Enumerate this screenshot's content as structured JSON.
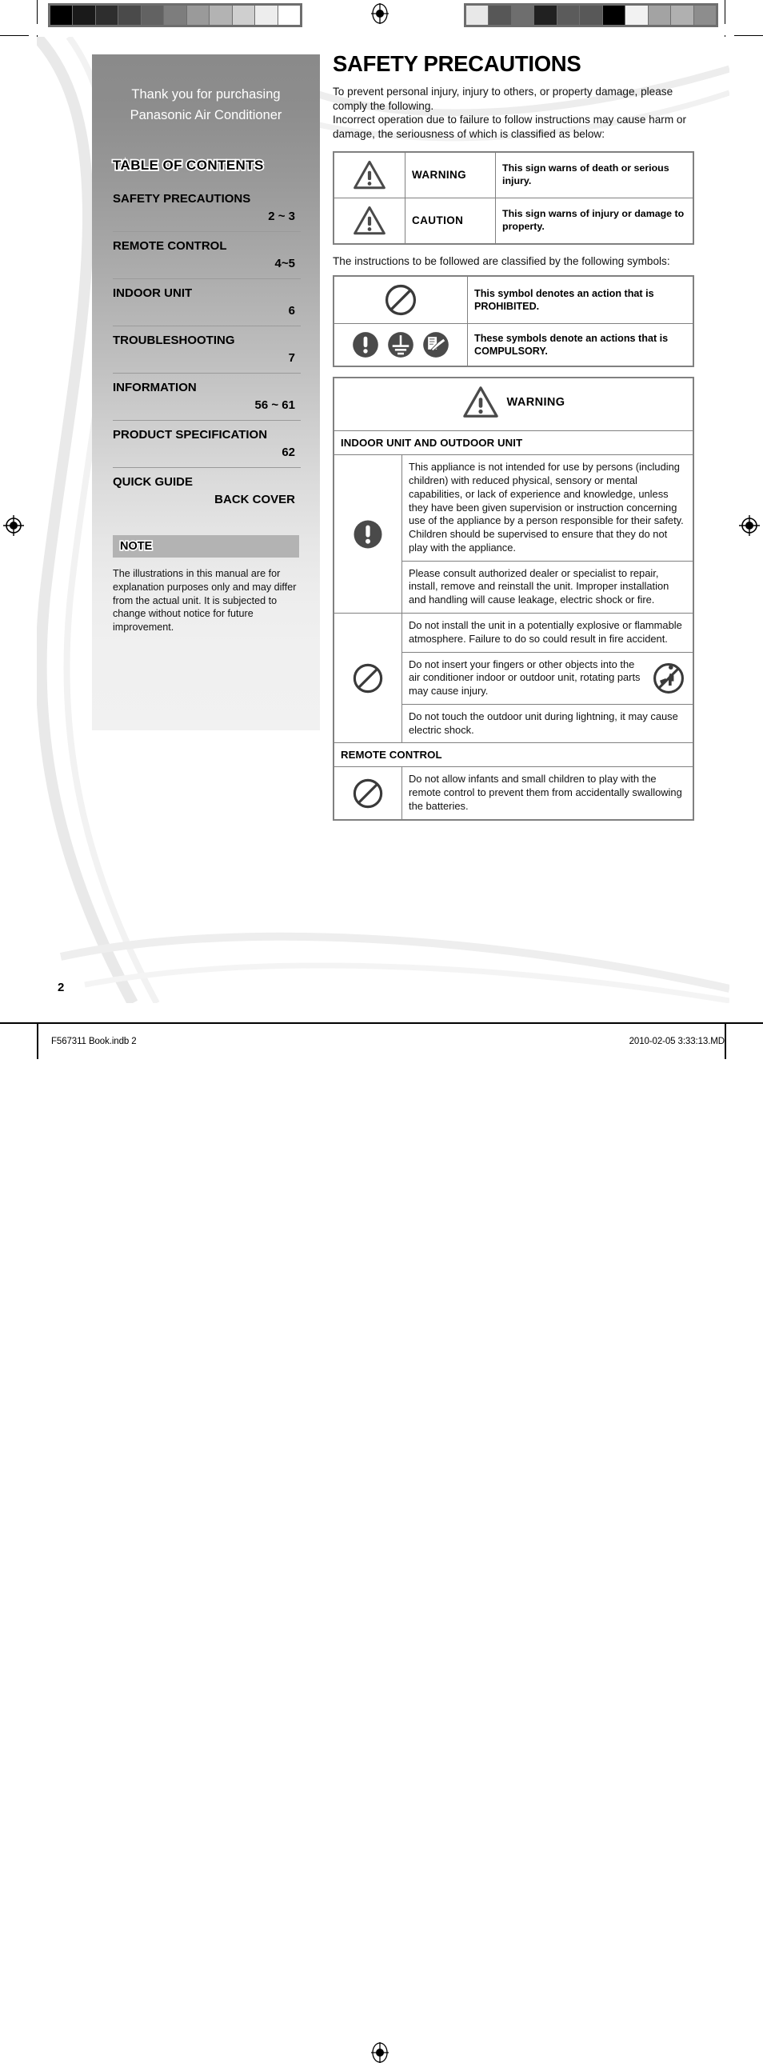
{
  "print_marks": {
    "left_strip_label": "grayscale-calibration-strip-left",
    "right_strip_label": "grayscale-calibration-strip-right",
    "left_swatches": [
      "#000000",
      "#1a1a1a",
      "#2e2e2e",
      "#4a4a4a",
      "#626262",
      "#7d7d7d",
      "#9a9a9a",
      "#b3b3b3",
      "#cfcfcf",
      "#ededed",
      "#ffffff"
    ],
    "right_swatches": [
      "#e8e8e8",
      "#575757",
      "#6e6e6e",
      "#212121",
      "#5b5b5b",
      "#585858",
      "#000000",
      "#f2f2f2",
      "#a3a3a3",
      "#b0b0b0",
      "#8d8d8d"
    ]
  },
  "sidebar": {
    "thanks_line1": "Thank you for purchasing",
    "thanks_line2": "Panasonic Air Conditioner",
    "toc_heading": "TABLE OF CONTENTS",
    "toc": [
      {
        "label": "SAFETY PRECAUTIONS",
        "page": "2 ~ 3"
      },
      {
        "label": "REMOTE CONTROL",
        "page": "4~5"
      },
      {
        "label": "INDOOR UNIT",
        "page": "6"
      },
      {
        "label": "TROUBLESHOOTING",
        "page": "7"
      },
      {
        "label": "INFORMATION",
        "page": "56 ~ 61"
      },
      {
        "label": "PRODUCT SPECIFICATION",
        "page": "62"
      },
      {
        "label": "QUICK GUIDE",
        "page": "BACK COVER"
      }
    ],
    "note_heading": "NOTE",
    "note_text": "The illustrations in this manual are for explanation purposes only and may differ from the actual unit. It is subjected to change without notice for future improvement."
  },
  "main": {
    "title": "SAFETY PRECAUTIONS",
    "intro_p1": "To prevent personal injury, injury to others, or property damage, please comply the following.",
    "intro_p2": "Incorrect operation due to failure to follow instructions may cause harm or damage, the seriousness of which is classified as below:",
    "sign_table": [
      {
        "icon": "warning-triangle-icon",
        "word": "WARNING",
        "desc": "This sign warns of death or serious injury."
      },
      {
        "icon": "warning-triangle-icon",
        "word": "CAUTION",
        "desc": "This sign warns of injury or damage to property."
      }
    ],
    "symbols_intro": "The instructions to be followed are classified by the following symbols:",
    "symbol_table": [
      {
        "icons": [
          "prohibition-circle-icon"
        ],
        "desc": "This symbol denotes an action that is PROHIBITED."
      },
      {
        "icons": [
          "compulsory-exclamation-icon",
          "earth-ground-icon",
          "read-manual-icon"
        ],
        "desc": "These symbols denote an actions that is COMPULSORY."
      }
    ],
    "warning_block": {
      "banner_label": "WARNING",
      "banner_icon": "warning-triangle-icon",
      "sections": [
        {
          "heading": "INDOOR UNIT AND OUTDOOR UNIT",
          "groups": [
            {
              "icon": "compulsory-exclamation-icon",
              "rows": [
                {
                  "text": "This appliance is not intended for use by persons (including children) with reduced physical, sensory or mental capabilities, or lack of experience and knowledge, unless they have been given supervision or instruction concerning use of the appliance by a person responsible for their safety. Children should be supervised to ensure that they do not play with the appliance."
                },
                {
                  "text": "Please consult authorized dealer or specialist to repair, install, remove and reinstall the unit. Improper installation and handling will cause leakage, electric shock or fire."
                }
              ]
            },
            {
              "icon": "prohibition-circle-icon",
              "rows": [
                {
                  "text": "Do not install the unit in a potentially explosive or flammable atmosphere. Failure to do so could result in fire accident."
                },
                {
                  "text": "Do not insert your fingers or other objects into the air conditioner indoor or outdoor unit, rotating parts may cause injury.",
                  "inline_icon": "no-hand-in-fan-icon"
                },
                {
                  "text": "Do not touch the outdoor unit during lightning, it may cause electric shock."
                }
              ]
            }
          ]
        },
        {
          "heading": "REMOTE CONTROL",
          "groups": [
            {
              "icon": "prohibition-circle-icon",
              "rows": [
                {
                  "text": "Do not allow infants and small children to play with the remote control to prevent them from accidentally swallowing the batteries."
                }
              ]
            }
          ]
        }
      ]
    },
    "page_number": "2"
  },
  "footer": {
    "left": "F567311 Book.indb   2",
    "right": "2010-02-05   3:33:13.MD"
  }
}
